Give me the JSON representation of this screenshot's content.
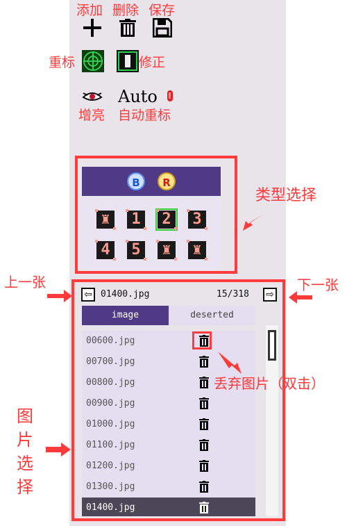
{
  "annotations": {
    "add": "添加",
    "delete": "删除",
    "save": "保存",
    "relabel": "重标",
    "correct": "修正",
    "enhance": "增亮",
    "auto_relabel": "自动重标",
    "type_select": "类型选择",
    "prev": "上一张",
    "next": "下一张",
    "discard": "丢弃图片（双击）",
    "image_select_chars": [
      "图",
      "片",
      "选",
      "择"
    ]
  },
  "toolbar": {
    "auto_label": "Auto"
  },
  "type_panel": {
    "header_buttons": [
      "B",
      "R"
    ],
    "tiles_row1": [
      "♜",
      "1",
      "2",
      "3"
    ],
    "tiles_row2": [
      "4",
      "5",
      "♜",
      "♜"
    ],
    "selected_tile": "2"
  },
  "image_nav": {
    "current_file": "01400.jpg",
    "counter": "15/318",
    "prev_icon": "⇦",
    "next_icon": "⇨"
  },
  "tabs": [
    "image",
    "deserted"
  ],
  "files": [
    "00600.jpg",
    "00700.jpg",
    "00800.jpg",
    "00900.jpg",
    "01000.jpg",
    "01100.jpg",
    "01200.jpg",
    "01300.jpg",
    "01400.jpg"
  ],
  "active_file": "01400.jpg",
  "colors": {
    "annotation_red": "#ff3a3a",
    "panel_purple": "#4f3a86",
    "selected_green": "#33cc33"
  }
}
